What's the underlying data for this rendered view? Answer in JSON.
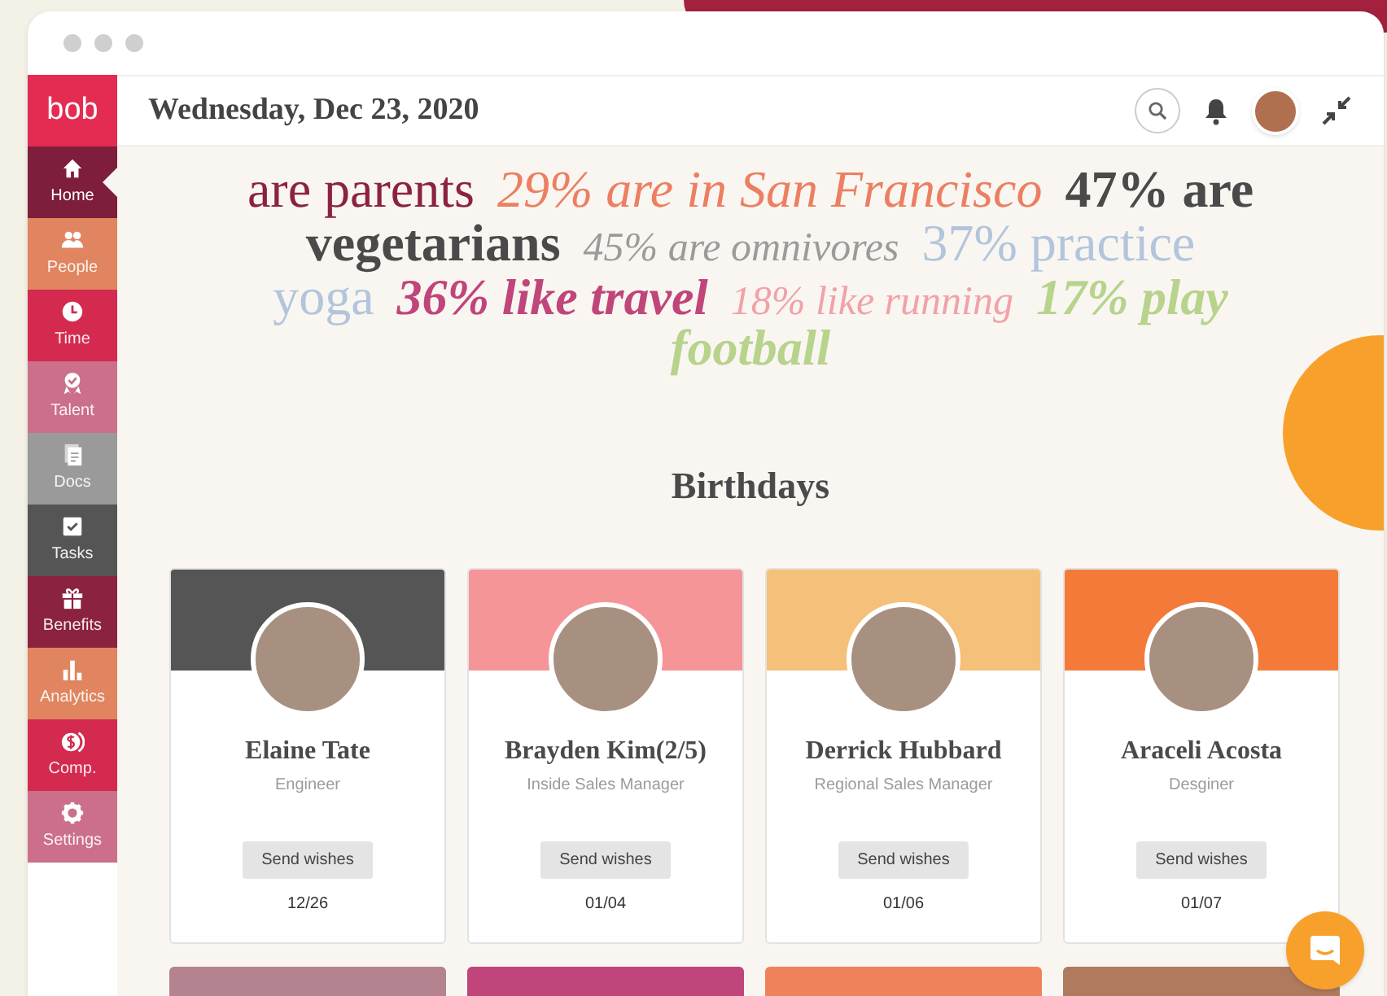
{
  "header": {
    "logo": "bob",
    "date": "Wednesday, Dec 23, 2020"
  },
  "sidebar": {
    "items": [
      {
        "label": "Home",
        "color": "#7e1d3c",
        "selected": true
      },
      {
        "label": "People",
        "color": "#e0855f",
        "selected": false
      },
      {
        "label": "Time",
        "color": "#d42a50",
        "selected": false
      },
      {
        "label": "Talent",
        "color": "#cc6f8a",
        "selected": false
      },
      {
        "label": "Docs",
        "color": "#9a9a9a",
        "selected": false
      },
      {
        "label": "Tasks",
        "color": "#555555",
        "selected": false
      },
      {
        "label": "Benefits",
        "color": "#8b2240",
        "selected": false
      },
      {
        "label": "Analytics",
        "color": "#e0855f",
        "selected": false
      },
      {
        "label": "Comp.",
        "color": "#d42a50",
        "selected": false
      },
      {
        "label": "Settings",
        "color": "#cc6f8a",
        "selected": false
      }
    ]
  },
  "word_cloud": [
    [
      {
        "text": "are parents",
        "kind": "plain",
        "color": "#8b2240"
      },
      {
        "text": "29% are in San Francisco",
        "kind": "italic",
        "color": "#ec7f62"
      },
      {
        "text": "47% are",
        "kind": "bold",
        "color": "#4a4a4a"
      }
    ],
    [
      {
        "text": "vegetarians",
        "kind": "bold",
        "color": "#4a4a4a"
      },
      {
        "text": "45% are omnivores",
        "kind": "italic-small",
        "color": "#9b9b9b"
      },
      {
        "text": "37% practice",
        "kind": "plain",
        "color": "#b3c5dc"
      }
    ],
    [
      {
        "text": "yoga",
        "kind": "plain",
        "color": "#b3c5dc"
      },
      {
        "text": "36% like travel",
        "kind": "bold-italic",
        "color": "#c0457a"
      },
      {
        "text": "18% like running",
        "kind": "italic-small",
        "color": "#f0a2a8"
      },
      {
        "text": "17% play",
        "kind": "bold-italic",
        "color": "#b7d38c"
      }
    ],
    [
      {
        "text": "football",
        "kind": "bold-italic",
        "color": "#b7d38c"
      }
    ]
  ],
  "birthdays": {
    "title": "Birthdays",
    "cards": [
      {
        "name": "Elaine Tate",
        "role": "Engineer",
        "button": "Send wishes",
        "date": "12/26",
        "color": "#555555"
      },
      {
        "name": "Brayden Kim(2/5)",
        "role": "Inside Sales Manager",
        "button": "Send wishes",
        "date": "01/04",
        "color": "#f59598"
      },
      {
        "name": "Derrick Hubbard",
        "role": "Regional Sales Manager",
        "button": "Send wishes",
        "date": "01/06",
        "color": "#f4c07a"
      },
      {
        "name": "Araceli Acosta",
        "role": "Desginer",
        "button": "Send wishes",
        "date": "01/07",
        "color": "#f47a3a"
      }
    ],
    "next_row": [
      {
        "color": "#b5838f"
      },
      {
        "color": "#c0457a"
      },
      {
        "color": "#f0825a"
      },
      {
        "color": "#b07a5e"
      }
    ]
  }
}
